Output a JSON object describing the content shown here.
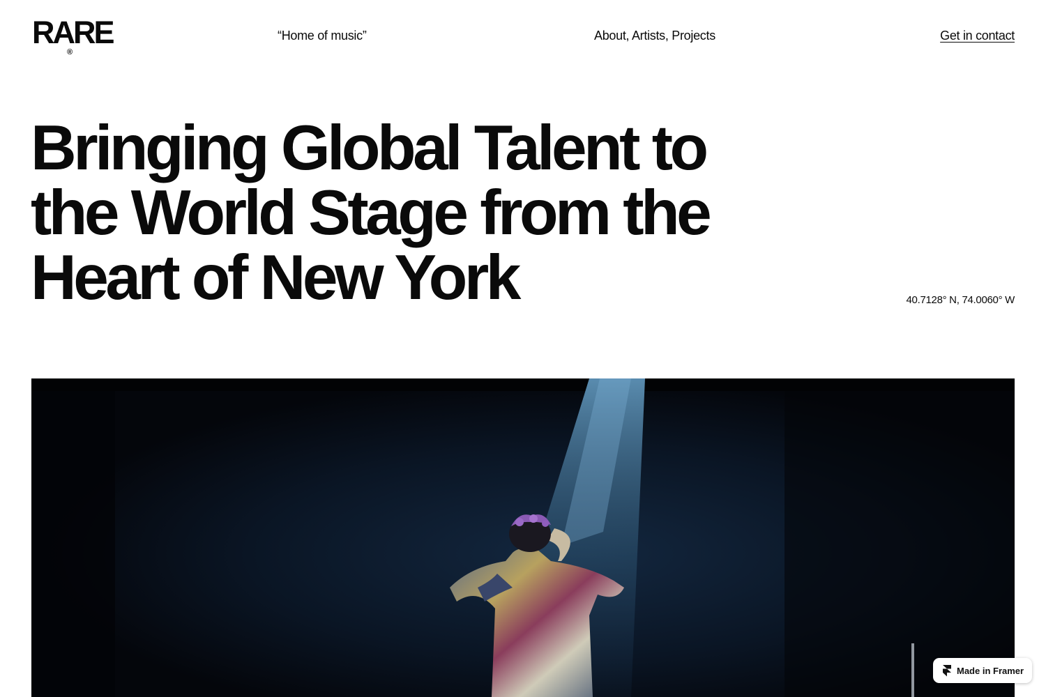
{
  "header": {
    "logo_text": "RARE",
    "logo_mark": "®",
    "tagline": "“Home of music”",
    "nav_items": [
      "About",
      "Artists",
      "Projects"
    ],
    "contact_label": "Get in contact"
  },
  "hero": {
    "headline_lines": [
      "Bringing Global Talent to",
      "the World Stage from the",
      "Heart of New York"
    ],
    "coordinates": "40.7128° N, 74.0060° W",
    "image_subject": "performer-on-stage-under-spotlight"
  },
  "badge": {
    "label": "Made in Framer",
    "icon": "framer-icon"
  },
  "colors": {
    "text": "#0a0a0a",
    "background": "#ffffff",
    "hero_background": "#05080f",
    "spotlight": "#3e6a8a"
  }
}
